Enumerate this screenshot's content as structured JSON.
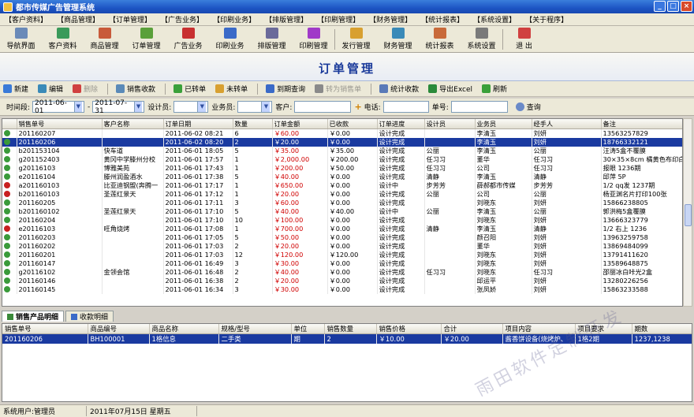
{
  "window": {
    "title": "都市传媒广告管理系统"
  },
  "menu": [
    "【客户资料】",
    "【商品管理】",
    "【订单管理】",
    "【广告业务】",
    "【印刷业务】",
    "【排版管理】",
    "【印刷管理】",
    "【财务管理】",
    "【统计报表】",
    "【系统设置】",
    "【关于程序】"
  ],
  "toolbar": [
    {
      "label": "导航界面",
      "icon": "navigation-icon",
      "color": "#6a8ab8"
    },
    {
      "label": "客户资料",
      "icon": "customer-icon",
      "color": "#3a9a5a"
    },
    {
      "label": "商品管理",
      "icon": "product-icon",
      "color": "#c85a3a"
    },
    {
      "label": "订单管理",
      "icon": "order-icon",
      "color": "#5aa03a"
    },
    {
      "label": "广告业务",
      "icon": "ads-icon",
      "color": "#c83030"
    },
    {
      "label": "印刷业务",
      "icon": "print-business-icon",
      "color": "#3a6ac8"
    },
    {
      "label": "排版管理",
      "icon": "layout-icon",
      "color": "#6a6a9a"
    },
    {
      "label": "印刷管理",
      "icon": "print-manage-icon",
      "color": "#a03ac8"
    },
    {
      "label": "发行管理",
      "icon": "distribution-icon",
      "color": "#d8a030"
    },
    {
      "label": "财务管理",
      "icon": "finance-icon",
      "color": "#3a8ab8"
    },
    {
      "label": "统计报表",
      "icon": "report-icon",
      "color": "#c86a3a"
    },
    {
      "label": "系统设置",
      "icon": "settings-icon",
      "color": "#7a7a7a"
    },
    {
      "label": "退 出",
      "icon": "exit-icon",
      "color": "#d04040"
    }
  ],
  "banner": {
    "title": "订单管理"
  },
  "actions": [
    {
      "label": "新建",
      "icon": "new-icon",
      "color": "#3a7ad8",
      "enabled": true
    },
    {
      "label": "编辑",
      "icon": "edit-icon",
      "color": "#3a8ab8",
      "enabled": true
    },
    {
      "label": "删除",
      "icon": "delete-icon",
      "color": "#d04040",
      "enabled": false
    },
    {
      "label": "销售收款",
      "icon": "payment-icon",
      "color": "#5a8ab8",
      "enabled": true
    },
    {
      "label": "已转单",
      "icon": "transferred-icon",
      "color": "#3aa03a",
      "enabled": true
    },
    {
      "label": "未转单",
      "icon": "untransferred-icon",
      "color": "#d8a030",
      "enabled": true
    },
    {
      "label": "到期查询",
      "icon": "due-query-icon",
      "color": "#3a6ac8",
      "enabled": true
    },
    {
      "label": "转为销售单",
      "icon": "convert-icon",
      "color": "#8a8a8a",
      "enabled": false
    },
    {
      "label": "统计收款",
      "icon": "stats-icon",
      "color": "#5a7ab8",
      "enabled": true
    },
    {
      "label": "导出Excel",
      "icon": "excel-icon",
      "color": "#2a8a3a",
      "enabled": true
    },
    {
      "label": "刷新",
      "icon": "refresh-icon",
      "color": "#3aa03a",
      "enabled": true
    }
  ],
  "filter": {
    "period_label": "时间段:",
    "date_from": "2011-06-01",
    "dash": "-",
    "date_to": "2011-07-31",
    "designer_label": "设计员:",
    "designer": "",
    "salesman_label": "业务员:",
    "salesman": "",
    "customer_label": "客户:",
    "customer": "",
    "plus": "+",
    "phone_label": "电话:",
    "phone": "",
    "order_no_label": "单号:",
    "order_no": "",
    "query_label": "查询"
  },
  "orders": {
    "columns": [
      "",
      "销售单号",
      "客户名称",
      "订单日期",
      "数量",
      "订单金额",
      "已收款",
      "订单进度",
      "设计员",
      "业务员",
      "经手人",
      "备注"
    ],
    "rows": [
      {
        "s": "ok",
        "no": "201160207",
        "cust": "",
        "date": "2011-06-02 08:21",
        "qty": "6",
        "amt": "￥60.00",
        "paid": "￥0.00",
        "prog": "设计完成",
        "des": "",
        "sales": "李清玉",
        "handler": "刘妍",
        "note": "13563257829"
      },
      {
        "s": "ok",
        "no": "201160206",
        "cust": "",
        "date": "2011-06-02 08:20",
        "qty": "2",
        "amt": "￥20.00",
        "paid": "￥0.00",
        "prog": "设计完成",
        "des": "",
        "sales": "李清玉",
        "handler": "刘妍",
        "note": "18766332121",
        "sel": true
      },
      {
        "s": "ok",
        "no": "b201153104",
        "cust": "快车道",
        "date": "2011-06-01 18:05",
        "qty": "5",
        "amt": "￥35.00",
        "paid": "￥35.00",
        "prog": "设计完成",
        "des": "公丽",
        "sales": "李清玉",
        "handler": "公丽",
        "note": "汪涛5盒不覆膜"
      },
      {
        "s": "ok",
        "no": "g201152403",
        "cust": "黄冈中学滕州分校",
        "date": "2011-06-01 17:57",
        "qty": "1",
        "amt": "￥2,000.00",
        "paid": "￥200.00",
        "prog": "设计完成",
        "des": "任习习",
        "sales": "董华",
        "handler": "任习习",
        "note": "30×35×8cm 橘黄色布印白"
      },
      {
        "s": "ok",
        "no": "g20116103",
        "cust": "博雅美苑",
        "date": "2011-06-01 17:43",
        "qty": "1",
        "amt": "￥200.00",
        "paid": "￥50.00",
        "prog": "设计完成",
        "des": "任习习",
        "sales": "公司",
        "handler": "任习习",
        "note": "报眼 1236期"
      },
      {
        "s": "ok",
        "no": "e20116104",
        "cust": "滕州润盈酒水",
        "date": "2011-06-01 17:38",
        "qty": "5",
        "amt": "￥40.00",
        "paid": "￥0.00",
        "prog": "设计完成",
        "des": "清静",
        "sales": "李清玉",
        "handler": "清静",
        "note": "邱萍 5P"
      },
      {
        "s": "no",
        "no": "a201160103",
        "cust": "比亚迪钢盟(奔腾一",
        "date": "2011-06-01 17:17",
        "qty": "1",
        "amt": "￥650.00",
        "paid": "￥0.00",
        "prog": "设计中",
        "des": "步芳芳",
        "sales": "薛郝都市传媒",
        "handler": "步芳芳",
        "note": "1/2 qq发 1237期"
      },
      {
        "s": "no",
        "no": "b201160103",
        "cust": "圣莲红景天",
        "date": "2011-06-01 17:12",
        "qty": "1",
        "amt": "￥20.00",
        "paid": "￥0.00",
        "prog": "设计完成",
        "des": "公丽",
        "sales": "公司",
        "handler": "公丽",
        "note": "杨亚渊名片打印100张"
      },
      {
        "s": "ok",
        "no": "201160205",
        "cust": "",
        "date": "2011-06-01 17:11",
        "qty": "3",
        "amt": "￥60.00",
        "paid": "￥0.00",
        "prog": "设计完成",
        "des": "",
        "sales": "刘晓东",
        "handler": "刘妍",
        "note": "15866238805"
      },
      {
        "s": "ok",
        "no": "b201160102",
        "cust": "圣莲红景天",
        "date": "2011-06-01 17:10",
        "qty": "5",
        "amt": "￥40.00",
        "paid": "￥40.00",
        "prog": "设计中",
        "des": "公丽",
        "sales": "李清玉",
        "handler": "公丽",
        "note": "郭洪梅5盒覆膜"
      },
      {
        "s": "ok",
        "no": "201160204",
        "cust": "",
        "date": "2011-06-01 17:10",
        "qty": "10",
        "amt": "￥100.00",
        "paid": "￥0.00",
        "prog": "设计完成",
        "des": "",
        "sales": "刘晓东",
        "handler": "刘妍",
        "note": "13666323779"
      },
      {
        "s": "no",
        "no": "e20116103",
        "cust": "旺角烧烤",
        "date": "2011-06-01 17:08",
        "qty": "1",
        "amt": "￥700.00",
        "paid": "￥0.00",
        "prog": "设计完成",
        "des": "清静",
        "sales": "李清玉",
        "handler": "清静",
        "note": "1/2 右上 1236"
      },
      {
        "s": "ok",
        "no": "201160203",
        "cust": "",
        "date": "2011-06-01 17:05",
        "qty": "5",
        "amt": "￥50.00",
        "paid": "￥0.00",
        "prog": "设计完成",
        "des": "",
        "sales": "颜召阳",
        "handler": "刘妍",
        "note": "13963259758"
      },
      {
        "s": "ok",
        "no": "201160202",
        "cust": "",
        "date": "2011-06-01 17:03",
        "qty": "2",
        "amt": "￥20.00",
        "paid": "￥0.00",
        "prog": "设计完成",
        "des": "",
        "sales": "董华",
        "handler": "刘妍",
        "note": "13869484099"
      },
      {
        "s": "ok",
        "no": "201160201",
        "cust": "",
        "date": "2011-06-01 17:03",
        "qty": "12",
        "amt": "￥120.00",
        "paid": "￥120.00",
        "prog": "设计完成",
        "des": "",
        "sales": "刘晓东",
        "handler": "刘妍",
        "note": "13791411620"
      },
      {
        "s": "ok",
        "no": "201160147",
        "cust": "",
        "date": "2011-06-01 16:49",
        "qty": "3",
        "amt": "￥30.00",
        "paid": "￥0.00",
        "prog": "设计完成",
        "des": "",
        "sales": "刘晓东",
        "handler": "刘妍",
        "note": "13589648875"
      },
      {
        "s": "ok",
        "no": "g20116102",
        "cust": "金领会馆",
        "date": "2011-06-01 16:48",
        "qty": "2",
        "amt": "￥40.00",
        "paid": "￥0.00",
        "prog": "设计完成",
        "des": "任习习",
        "sales": "刘晓东",
        "handler": "任习习",
        "note": "邵丽冰白咔光2盒"
      },
      {
        "s": "ok",
        "no": "201160146",
        "cust": "",
        "date": "2011-06-01 16:38",
        "qty": "2",
        "amt": "￥20.00",
        "paid": "￥0.00",
        "prog": "设计完成",
        "des": "",
        "sales": "邱运平",
        "handler": "刘妍",
        "note": "13280226256"
      },
      {
        "s": "ok",
        "no": "201160145",
        "cust": "",
        "date": "2011-06-01 16:34",
        "qty": "3",
        "amt": "￥30.00",
        "paid": "￥0.00",
        "prog": "设计完成",
        "des": "",
        "sales": "张凤娇",
        "handler": "刘妍",
        "note": "15863233588"
      }
    ]
  },
  "bottom_tabs": [
    "销售产品明细",
    "收款明细"
  ],
  "details": {
    "columns": [
      "销售单号",
      "商品编号",
      "商品名称",
      "规格/型号",
      "单位",
      "销售数量",
      "销售价格",
      "合计",
      "项目内容",
      "项目要求",
      "期数"
    ],
    "rows": [
      {
        "no": "201160206",
        "code": "BH100001",
        "name": "1格信息",
        "spec": "二手类",
        "unit": "期",
        "qty": "2",
        "price": "￥10.00",
        "total": "￥20.00",
        "content": "酱香饼设备(烧烤炉、",
        "req": "1格2期",
        "issue": "1237,1238"
      }
    ]
  },
  "status": {
    "user_label": "系统用户:管理员",
    "date": "2011年07月15日 星期五"
  },
  "watermark": "雨田软件定制开发"
}
